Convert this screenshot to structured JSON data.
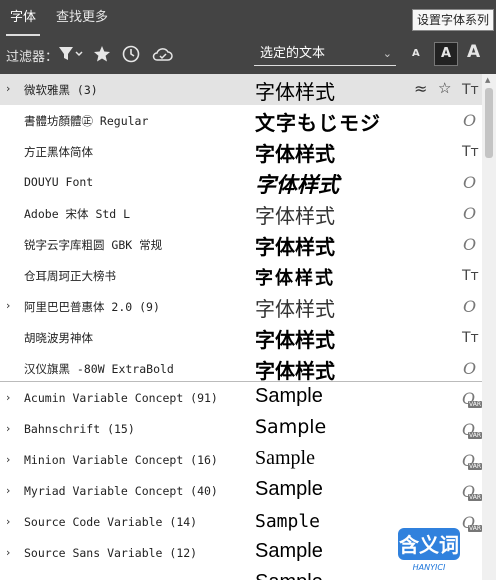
{
  "tabs": [
    {
      "label": "字体"
    },
    {
      "label": "查找更多"
    }
  ],
  "tooltip": "设置字体系列",
  "filter": {
    "label": "过滤器：",
    "sample_text": "选定的文本",
    "size_small": "A",
    "size_medium": "A",
    "size_large": "A"
  },
  "fonts": [
    {
      "name": "微软雅黑 (3)",
      "sample": "字体样式",
      "expand": "›",
      "highlighted": true
    },
    {
      "name": "書體坊顏體㊣ Regular",
      "sample": "文字もじモジ"
    },
    {
      "name": "方正黑体简体",
      "sample": "字体样式"
    },
    {
      "name": "DOUYU Font",
      "sample": "字体样式"
    },
    {
      "name": "Adobe 宋体 Std L",
      "sample": "字体样式"
    },
    {
      "name": "锐字云字库粗圆 GBK 常规",
      "sample": "字体样式"
    },
    {
      "name": "仓耳周珂正大榜书",
      "sample": "字体样式"
    },
    {
      "name": "阿里巴巴普惠体 2.0 (9)",
      "sample": "字体样式",
      "expand": "›"
    },
    {
      "name": "胡晓波男神体",
      "sample": "字体样式"
    },
    {
      "name": "汉仪旗黑 -80W ExtraBold",
      "sample": "字体样式"
    },
    {
      "name": "Acumin Variable Concept (91)",
      "sample": "Sample",
      "expand": "›"
    },
    {
      "name": "Bahnschrift (15)",
      "sample": "Sample",
      "expand": "›"
    },
    {
      "name": "Minion Variable Concept (16)",
      "sample": "Sample",
      "expand": "›"
    },
    {
      "name": "Myriad Variable Concept (40)",
      "sample": "Sample",
      "expand": "›"
    },
    {
      "name": "Source Code Variable (14)",
      "sample": "Sample",
      "expand": "›"
    },
    {
      "name": "Source Sans Variable (12)",
      "sample": "Sample",
      "expand": "›"
    },
    {
      "name": "",
      "sample": "Sample",
      "expand": ""
    }
  ],
  "watermark": {
    "main": "含义词",
    "sub": "HANYICI"
  }
}
